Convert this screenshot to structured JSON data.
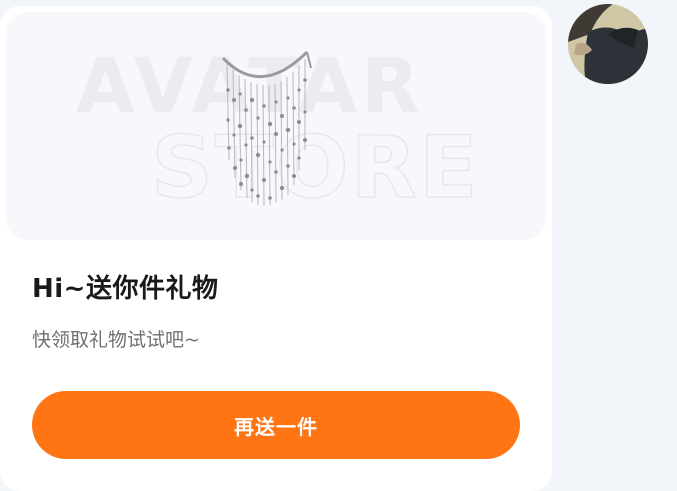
{
  "banner": {
    "watermark_line1": "AVATAR",
    "watermark_line2": "STORE",
    "gift_item_icon": "beaded-headpiece-icon"
  },
  "gift": {
    "title": "Hi~送你件礼物",
    "subtitle": "快领取礼物试试吧~"
  },
  "action": {
    "button_label": "再送一件"
  },
  "colors": {
    "accent": "#ff7413",
    "page_bg": "#f2f5f9",
    "card_bg": "#ffffff",
    "banner_bg": "#f6f8fb"
  },
  "avatar": {
    "icon": "user-avatar-icon"
  }
}
